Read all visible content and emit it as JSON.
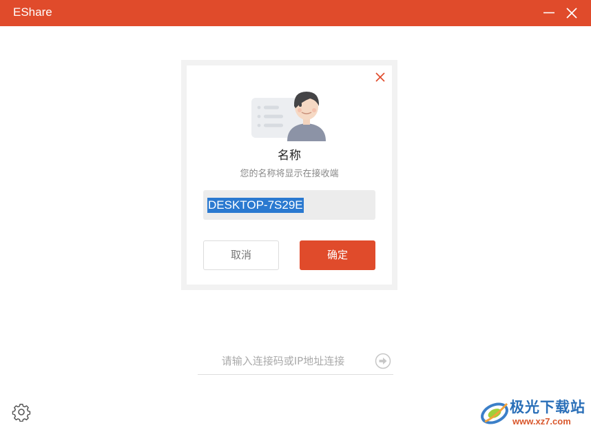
{
  "window": {
    "title": "EShare",
    "accent_color": "#e04b2b",
    "minimize_icon": "minimize-icon",
    "close_icon": "close-icon"
  },
  "dialog": {
    "title": "名称",
    "subtitle": "您的名称将显示在接收端",
    "name_value": "DESKTOP-7S29E",
    "cancel_label": "取消",
    "confirm_label": "确定",
    "close_icon": "close-icon",
    "illustration_icon": "user-card-icon"
  },
  "connect": {
    "placeholder": "请输入连接码或IP地址连接",
    "submit_icon": "arrow-right-circle-icon"
  },
  "settings": {
    "icon": "gear-icon"
  },
  "watermark": {
    "brand": "极光下载站",
    "url": "www.xz7.com"
  }
}
